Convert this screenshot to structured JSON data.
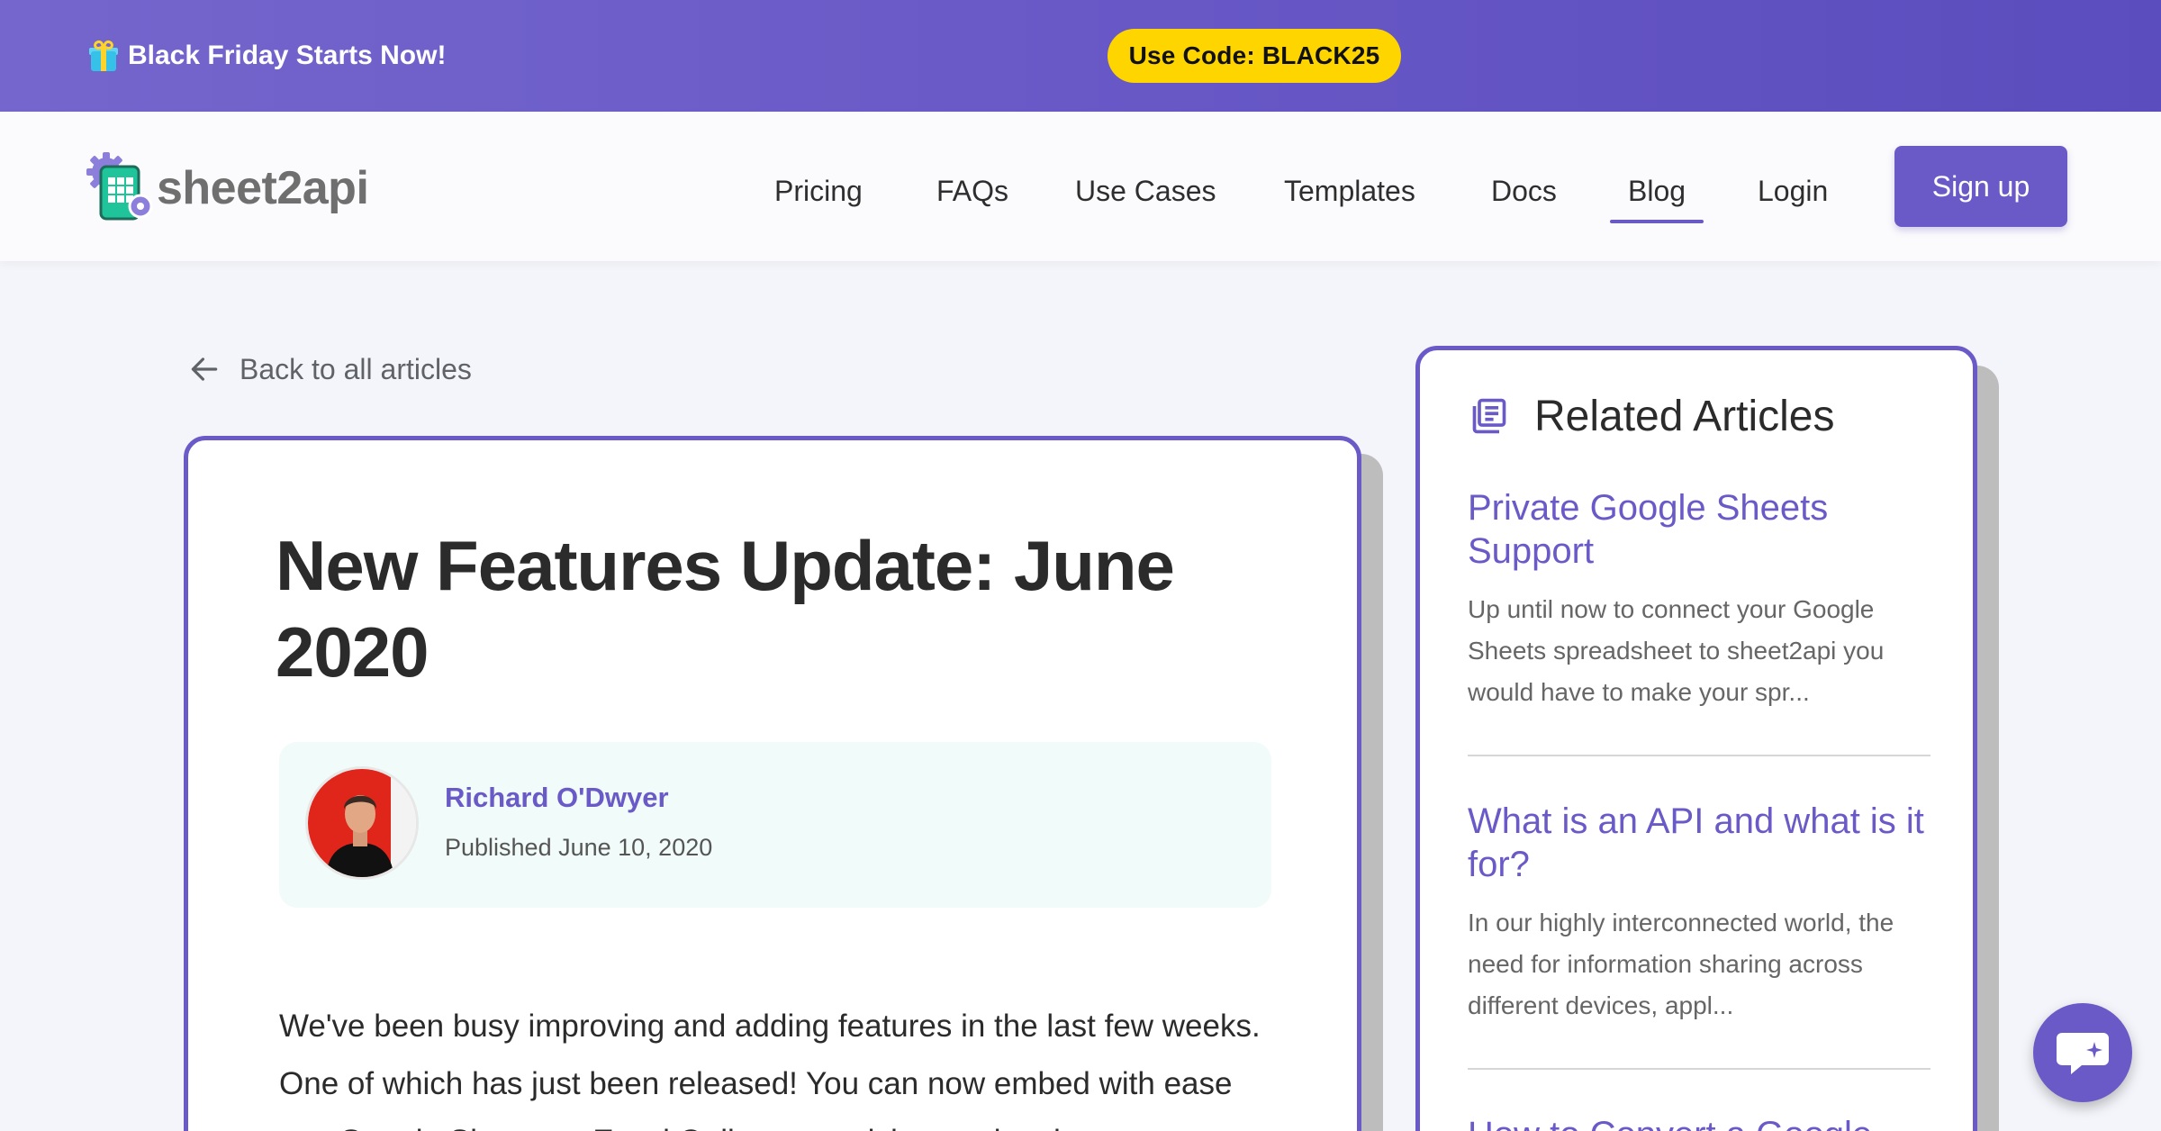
{
  "promo": {
    "text": "Black Friday Starts Now!",
    "code": "Use Code: BLACK25",
    "icon": "gift-icon"
  },
  "header": {
    "logo_text": "sheet2api",
    "nav": [
      {
        "label": "Pricing"
      },
      {
        "label": "FAQs"
      },
      {
        "label": "Use Cases"
      },
      {
        "label": "Templates"
      },
      {
        "label": "Docs"
      },
      {
        "label": "Blog",
        "active": true
      },
      {
        "label": "Login"
      }
    ],
    "signup_label": "Sign up"
  },
  "back_link": "Back to all articles",
  "article": {
    "title": "New Features Update: June 2020",
    "author": "Richard O'Dwyer",
    "published": "Published June 10, 2020",
    "body": "We've been busy improving and adding features in the last few weeks. One of which has just been released! You can now embed with ease any Google Sheets or Excel Online spreadsheet using the new"
  },
  "related": {
    "title": "Related Articles",
    "items": [
      {
        "title": "Private Google Sheets Support",
        "excerpt": "Up until now to connect your Google Sheets spreadsheet to sheet2api you would have to make your spr..."
      },
      {
        "title": "What is an API and what is it for?",
        "excerpt": "In our highly interconnected world, the need for information sharing across different devices, appl..."
      },
      {
        "title": "How to Convert a Google",
        "excerpt": ""
      }
    ]
  },
  "colors": {
    "accent": "#6a5ac8",
    "promo_code_bg": "#ffd500",
    "author_box_bg": "#f1fbf9"
  }
}
